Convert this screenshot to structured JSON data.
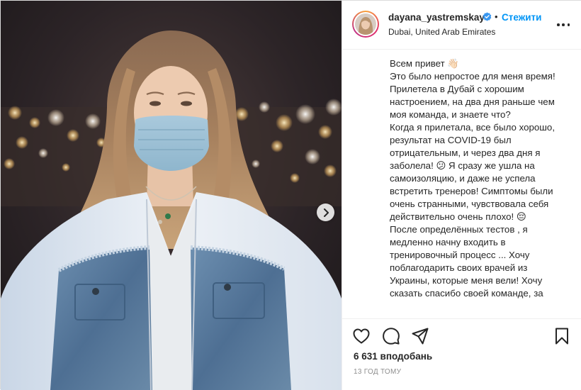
{
  "post": {
    "username": "dayana_yastremskay",
    "separator": "•",
    "follow_label": "Стежити",
    "location": "Dubai, United Arab Emirates",
    "caption": "Всем привет 👋🏻\nЭто было непростое для меня время!\nПрилетела в Дубай с хорошим настроением, на два дня раньше чем моя команда, и знаете что?\nКогда я прилетала, все было хорошо, результат на COVID-19 был отрицательным, и через два дня я заболела! 😕 Я сразу же ушла на самоизоляцию, и даже не успела встретить тренеров! Симптомы были очень странными, чувствовала себя действительно очень плохо! 😔\nПосле определённых тестов , я медленно начну входить в тренировочный процесс ... Хочу поблагодарить своих врачей из Украины, которые меня вели! Хочу сказать спасибо своей команде, за",
    "likes": "6 631 вподобань",
    "timestamp": "13 ГОД ТОМУ"
  },
  "icons": {
    "verified": "verified-badge-icon",
    "more": "more-options-icon",
    "like": "heart-icon",
    "comment": "comment-icon",
    "share": "paper-plane-icon",
    "save": "bookmark-icon",
    "next": "chevron-right-icon"
  },
  "colors": {
    "accent": "#0095f6",
    "text": "#262626",
    "muted": "#8e8e8e",
    "border": "#efefef"
  }
}
